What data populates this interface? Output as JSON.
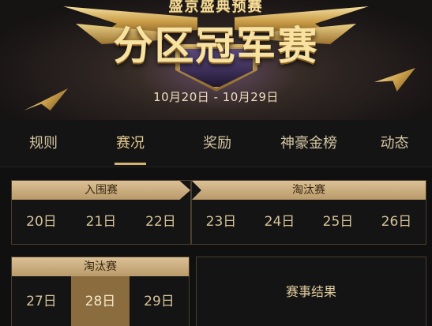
{
  "banner": {
    "subtitle": "盛京盛典预赛",
    "title": "分区冠军赛",
    "dates": "10月20日 - 10月29日"
  },
  "tabs": [
    {
      "label": "规则",
      "active": false
    },
    {
      "label": "赛况",
      "active": true
    },
    {
      "label": "奖励",
      "active": false
    },
    {
      "label": "神豪金榜",
      "active": false
    },
    {
      "label": "动态",
      "active": false
    }
  ],
  "schedule": {
    "group_stage": {
      "label": "入围赛",
      "days": [
        "20日",
        "21日",
        "22日"
      ]
    },
    "knockout_1": {
      "label": "淘汰赛",
      "days": [
        "23日",
        "24日",
        "25日",
        "26日"
      ]
    },
    "knockout_2": {
      "label": "淘汰赛",
      "days": [
        "27日",
        "28日",
        "29日"
      ],
      "selected": "28日"
    },
    "results_label": "赛事结果"
  },
  "colors": {
    "accent": "#d7b370",
    "selected_day_bg": "#8a6c3f",
    "header_bg": "#dcc196",
    "page_bg": "#101010"
  }
}
